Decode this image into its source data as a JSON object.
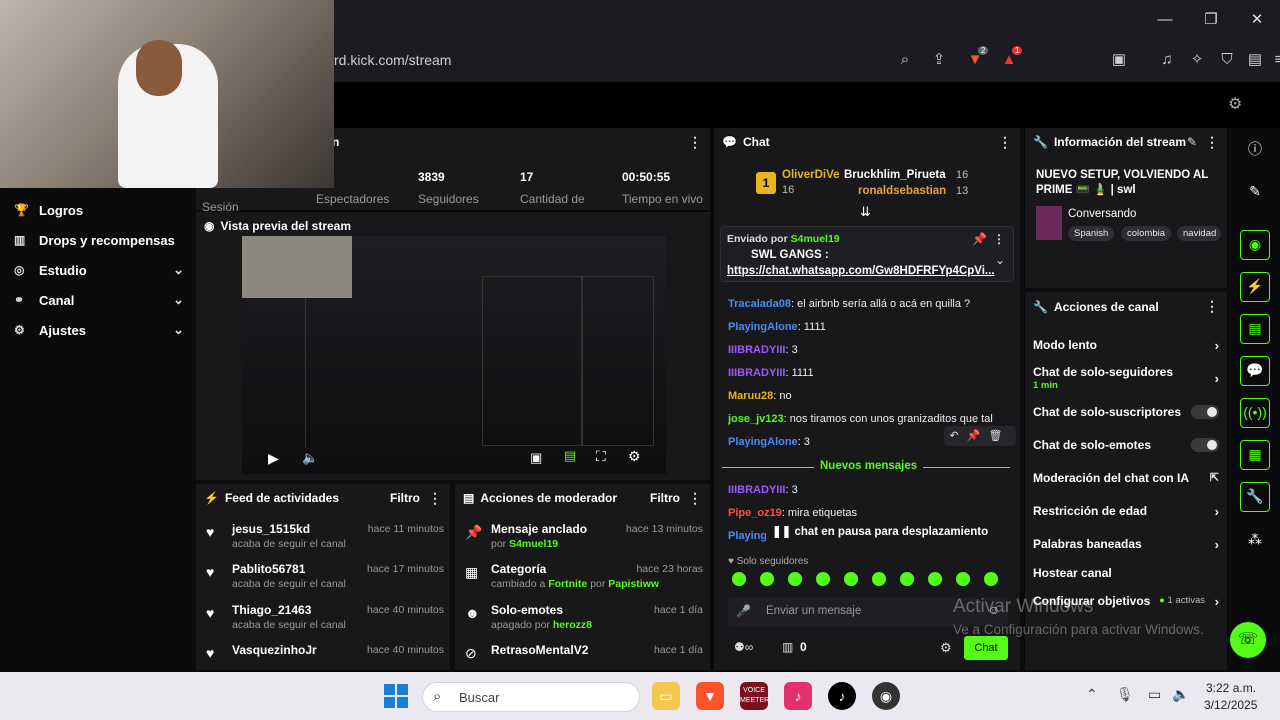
{
  "browser": {
    "url": "rd.kick.com/stream",
    "window_controls": [
      "minimize",
      "restore",
      "close"
    ],
    "brave_badge": "2",
    "alert_badge": "1"
  },
  "sidebar": {
    "items": [
      {
        "label": "Logros",
        "icon": "trophy-icon",
        "expandable": false
      },
      {
        "label": "Drops y recompensas",
        "icon": "gift-icon",
        "expandable": false
      },
      {
        "label": "Estudio",
        "icon": "studio-icon",
        "expandable": true
      },
      {
        "label": "Canal",
        "icon": "channel-icon",
        "expandable": true
      },
      {
        "label": "Ajustes",
        "icon": "gear-icon",
        "expandable": true
      }
    ]
  },
  "session": {
    "title": "n",
    "truncated_label": "Sesión",
    "stats": [
      {
        "value": "",
        "label": "Espectadores"
      },
      {
        "value": "3839",
        "label": "Seguidores"
      },
      {
        "value": "17",
        "label": "Cantidad de"
      },
      {
        "value": "00:50:55",
        "label": "Tiempo en vivo"
      }
    ]
  },
  "preview": {
    "title": "Vista previa del stream"
  },
  "feed": {
    "title": "Feed de actividades",
    "filter": "Filtro",
    "items": [
      {
        "name": "jesus_1515kd",
        "sub": "acaba de seguir el canal",
        "time": "hace 11 minutos"
      },
      {
        "name": "Pablito56781",
        "sub": "acaba de seguir el canal",
        "time": "hace 17 minutos"
      },
      {
        "name": "Thiago_21463",
        "sub": "acaba de seguir el canal",
        "time": "hace 40 minutos"
      },
      {
        "name": "VasquezinhoJr",
        "sub": "",
        "time": "hace 40 minutos"
      }
    ]
  },
  "mod": {
    "title": "Acciones de moderador",
    "filter": "Filtro",
    "items": [
      {
        "name": "Mensaje anclado",
        "sub_prefix": "por ",
        "sub_user": "S4muel19",
        "sub_mid": "",
        "sub_user2": "",
        "time": "hace 13 minutos",
        "icon": "pin-icon"
      },
      {
        "name": "Categoría",
        "sub_prefix": "cambiado a ",
        "sub_user": "Fortnite",
        "sub_mid": " por ",
        "sub_user2": "Papistiww",
        "time": "hace 23 horas",
        "icon": "category-icon"
      },
      {
        "name": "Solo-emotes",
        "sub_prefix": "apagado por ",
        "sub_user": "herozz8",
        "sub_mid": "",
        "sub_user2": "",
        "time": "hace 1 día",
        "icon": "emote-icon"
      },
      {
        "name": "RetrasoMentalV2",
        "sub_prefix": "",
        "sub_user": "",
        "sub_mid": "",
        "sub_user2": "",
        "time": "hace 1 día",
        "icon": "ban-icon"
      }
    ]
  },
  "chat": {
    "title": "Chat",
    "leaderboard": [
      {
        "rank": "1",
        "name": "OliverDiVe",
        "count": "16"
      },
      {
        "rank": "",
        "name": "Bruckhlim_Pirueta",
        "count": "16"
      },
      {
        "rank": "",
        "name": "ronaldsebastian",
        "count": "13"
      }
    ],
    "pinned": {
      "by_label": "Enviado por",
      "by_user": "S4muel19",
      "title": "SWL GANGS :",
      "link": "https://chat.whatsapp.com/Gw8HDFRFYp4CpVi..."
    },
    "messages": [
      {
        "user": "Tracalada08",
        "text": ": el airbnb sería allá o acá en quilla ?",
        "color": "blue"
      },
      {
        "user": "PlayingAlone",
        "text": ": 1111",
        "color": "blue"
      },
      {
        "user": "IIIBRADYIII",
        "text": ": 3",
        "color": "purple"
      },
      {
        "user": "IIIBRADYIII",
        "text": ": 1111",
        "color": "purple"
      },
      {
        "user": "Maruu28",
        "text": ": no",
        "color": "gold"
      },
      {
        "user": "jose_jv123",
        "text": ": nos tiramos con unos granizaditos que tal",
        "color": "green"
      },
      {
        "user": "PlayingAlone",
        "text": ": 3",
        "color": "blue"
      }
    ],
    "new_messages": "Nuevos mensajes",
    "after_messages": [
      {
        "user": "IIIBRADYIII",
        "text": ": 3",
        "color": "purple"
      },
      {
        "user": "Pipe_oz19",
        "text": ": mira etiquetas",
        "color": "red"
      },
      {
        "user": "Playing",
        "text": "",
        "color": "blue"
      }
    ],
    "paused": "chat en pausa para desplazamiento",
    "followers_only": "Solo seguidores",
    "input_placeholder": "Enviar un mensaje",
    "viewer_count": "0",
    "send_label": "Chat"
  },
  "stream_info": {
    "title": "Información del stream",
    "stream_title": "NUEVO SETUP, VOLVIENDO AL PRIME 📟 🎍 | swl",
    "category": "Conversando",
    "tags": [
      "Spanish",
      "colombia",
      "navidad"
    ]
  },
  "channel_actions": {
    "title": "Acciones de canal",
    "items": [
      {
        "label": "Modo lento",
        "sub": "",
        "control": "chevron"
      },
      {
        "label": "Chat de solo-seguidores",
        "sub": "1 min",
        "control": "chevron"
      },
      {
        "label": "Chat de solo-suscriptores",
        "sub": "",
        "control": "toggle"
      },
      {
        "label": "Chat de solo-emotes",
        "sub": "",
        "control": "toggle"
      },
      {
        "label": "Moderación del chat con IA",
        "sub": "",
        "control": "external"
      },
      {
        "label": "Restricción de edad",
        "sub": "",
        "control": "chevron"
      },
      {
        "label": "Palabras baneadas",
        "sub": "",
        "control": "chevron"
      },
      {
        "label": "Hostear canal",
        "sub": "",
        "control": "none"
      },
      {
        "label": "Configurar objetivos",
        "sub": "1 activas",
        "control": "chevron"
      }
    ]
  },
  "watermark": {
    "line1": "Activar Windows",
    "line2": "Ve a Configuración para activar Windows."
  },
  "taskbar": {
    "search_placeholder": "Buscar",
    "time": "3:22 a.m.",
    "date": "3/12/2025"
  }
}
